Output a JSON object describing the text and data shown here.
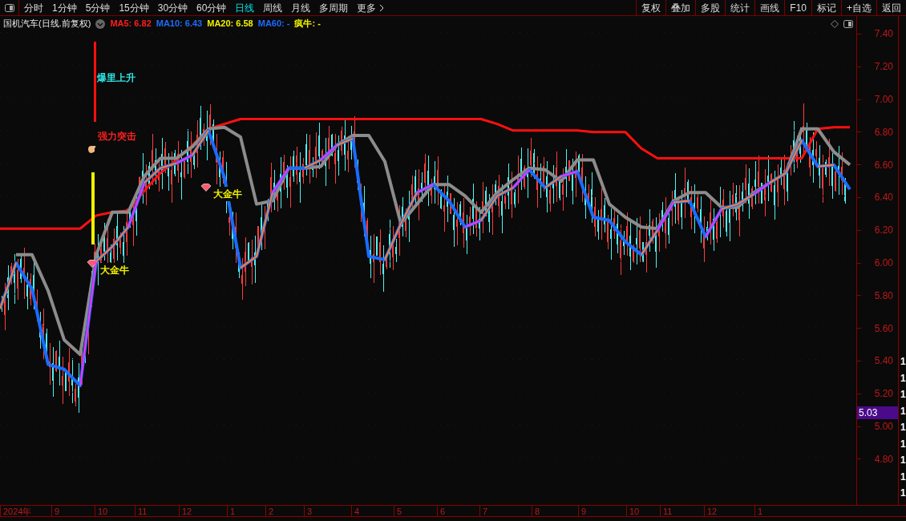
{
  "toolbar": {
    "tabs": [
      {
        "label": "分时",
        "selected": false
      },
      {
        "label": "1分钟",
        "selected": false
      },
      {
        "label": "5分钟",
        "selected": false
      },
      {
        "label": "15分钟",
        "selected": false
      },
      {
        "label": "30分钟",
        "selected": false
      },
      {
        "label": "60分钟",
        "selected": false
      },
      {
        "label": "日线",
        "selected": true
      },
      {
        "label": "周线",
        "selected": false
      },
      {
        "label": "月线",
        "selected": false
      },
      {
        "label": "多周期",
        "selected": false
      },
      {
        "label": "更多",
        "selected": false
      }
    ],
    "buttons": [
      "复权",
      "叠加",
      "多股",
      "统计",
      "画线",
      "F10",
      "标记",
      "+自选",
      "返回"
    ]
  },
  "legend": {
    "title": "国机汽车(日线.前复权)",
    "indicators": [
      {
        "label": "MA5: 6.82",
        "color": "#ff1e1e"
      },
      {
        "label": "MA10: 6.43",
        "color": "#1e6bff"
      },
      {
        "label": "MA20: 6.58",
        "color": "#f0f000"
      },
      {
        "label": "MA60: -",
        "color": "#1e6bff"
      },
      {
        "label": "疯牛: -",
        "color": "#f0f000"
      }
    ]
  },
  "chart": {
    "annotations": [
      {
        "kind": "text",
        "label": "爆里上升",
        "color": "#2ee6e6"
      },
      {
        "kind": "text",
        "label": "强力突击",
        "color": "#ff2020"
      },
      {
        "kind": "signal",
        "label": "大金牛",
        "color": "#f0f000"
      },
      {
        "kind": "signal",
        "label": "大金牛",
        "color": "#f0f000"
      }
    ],
    "chart_data": {
      "type": "line",
      "ylim": [
        4.51,
        7.5
      ],
      "grid": true,
      "yticks": [
        {
          "value": 7.4,
          "label": "7.40"
        },
        {
          "value": 7.2,
          "label": "7.20"
        },
        {
          "value": 7.0,
          "label": "7.00"
        },
        {
          "value": 6.8,
          "label": "6.80"
        },
        {
          "value": 6.6,
          "label": "6.60"
        },
        {
          "value": 6.4,
          "label": "6.40"
        },
        {
          "value": 6.2,
          "label": "6.20"
        },
        {
          "value": 6.0,
          "label": "6.00"
        },
        {
          "value": 5.8,
          "label": "5.80"
        },
        {
          "value": 5.6,
          "label": "5.60"
        },
        {
          "value": 5.4,
          "label": "5.40"
        },
        {
          "value": 5.2,
          "label": "5.20"
        },
        {
          "value": 5.0,
          "label": "5.00"
        },
        {
          "value": 4.8,
          "label": "4.80"
        }
      ],
      "series": [
        {
          "color": "#ff1010",
          "values": [
            6.2,
            6.2,
            6.2,
            6.2,
            6.2,
            6.2,
            6.28,
            6.3,
            6.31,
            6.43,
            6.54,
            6.62,
            6.71,
            6.81,
            6.84,
            6.87,
            6.87,
            6.87,
            6.87,
            6.87,
            6.87,
            6.87,
            6.87,
            6.87,
            6.87,
            6.87,
            6.87,
            6.87,
            6.87,
            6.87,
            6.87,
            6.84,
            6.8,
            6.8,
            6.8,
            6.8,
            6.8,
            6.79,
            6.79,
            6.79,
            6.69,
            6.63,
            6.63,
            6.63,
            6.63,
            6.63,
            6.63,
            6.63,
            6.63,
            6.63,
            6.63,
            6.81,
            6.82,
            6.82
          ]
        },
        {
          "color": "#8c8c8c",
          "values": [
            null,
            6.04,
            6.04,
            5.82,
            5.52,
            5.43,
            6.04,
            6.3,
            6.3,
            6.52,
            6.63,
            6.63,
            6.7,
            6.81,
            6.82,
            6.76,
            6.35,
            6.37,
            6.57,
            6.57,
            6.58,
            6.71,
            6.77,
            6.77,
            6.61,
            6.23,
            6.35,
            6.47,
            6.47,
            6.4,
            6.3,
            6.42,
            6.5,
            6.57,
            6.56,
            6.49,
            6.62,
            6.62,
            6.35,
            6.27,
            6.21,
            6.2,
            6.37,
            6.42,
            6.42,
            6.33,
            6.33,
            6.42,
            6.48,
            6.54,
            6.81,
            6.81,
            6.67,
            6.59
          ]
        },
        {
          "color": "#1a6cff",
          "values": [
            5.71,
            5.99,
            5.83,
            5.37,
            5.34,
            5.24,
            6.0,
            6.09,
            6.21,
            6.48,
            6.57,
            6.6,
            6.65,
            6.8,
            6.51,
            5.96,
            6.03,
            6.42,
            6.57,
            6.57,
            6.62,
            6.71,
            6.75,
            6.03,
            6.01,
            6.23,
            6.42,
            6.47,
            6.37,
            6.21,
            6.25,
            6.4,
            6.45,
            6.56,
            6.45,
            6.52,
            6.55,
            6.27,
            6.25,
            6.12,
            6.04,
            6.19,
            6.36,
            6.37,
            6.15,
            6.32,
            6.35,
            6.41,
            6.48,
            6.54,
            6.74,
            6.58,
            6.59,
            6.44
          ]
        }
      ]
    },
    "price_marker": "5.03",
    "x_axis": [
      "2024年",
      "9",
      "10",
      "11",
      "12",
      "1",
      "2",
      "3",
      "4",
      "5",
      "6",
      "7",
      "8",
      "9",
      "10",
      "11",
      "12",
      "1"
    ]
  },
  "side_list": [
    "1",
    "1",
    "1",
    "1",
    "1",
    "1",
    "1",
    "1",
    "1"
  ]
}
